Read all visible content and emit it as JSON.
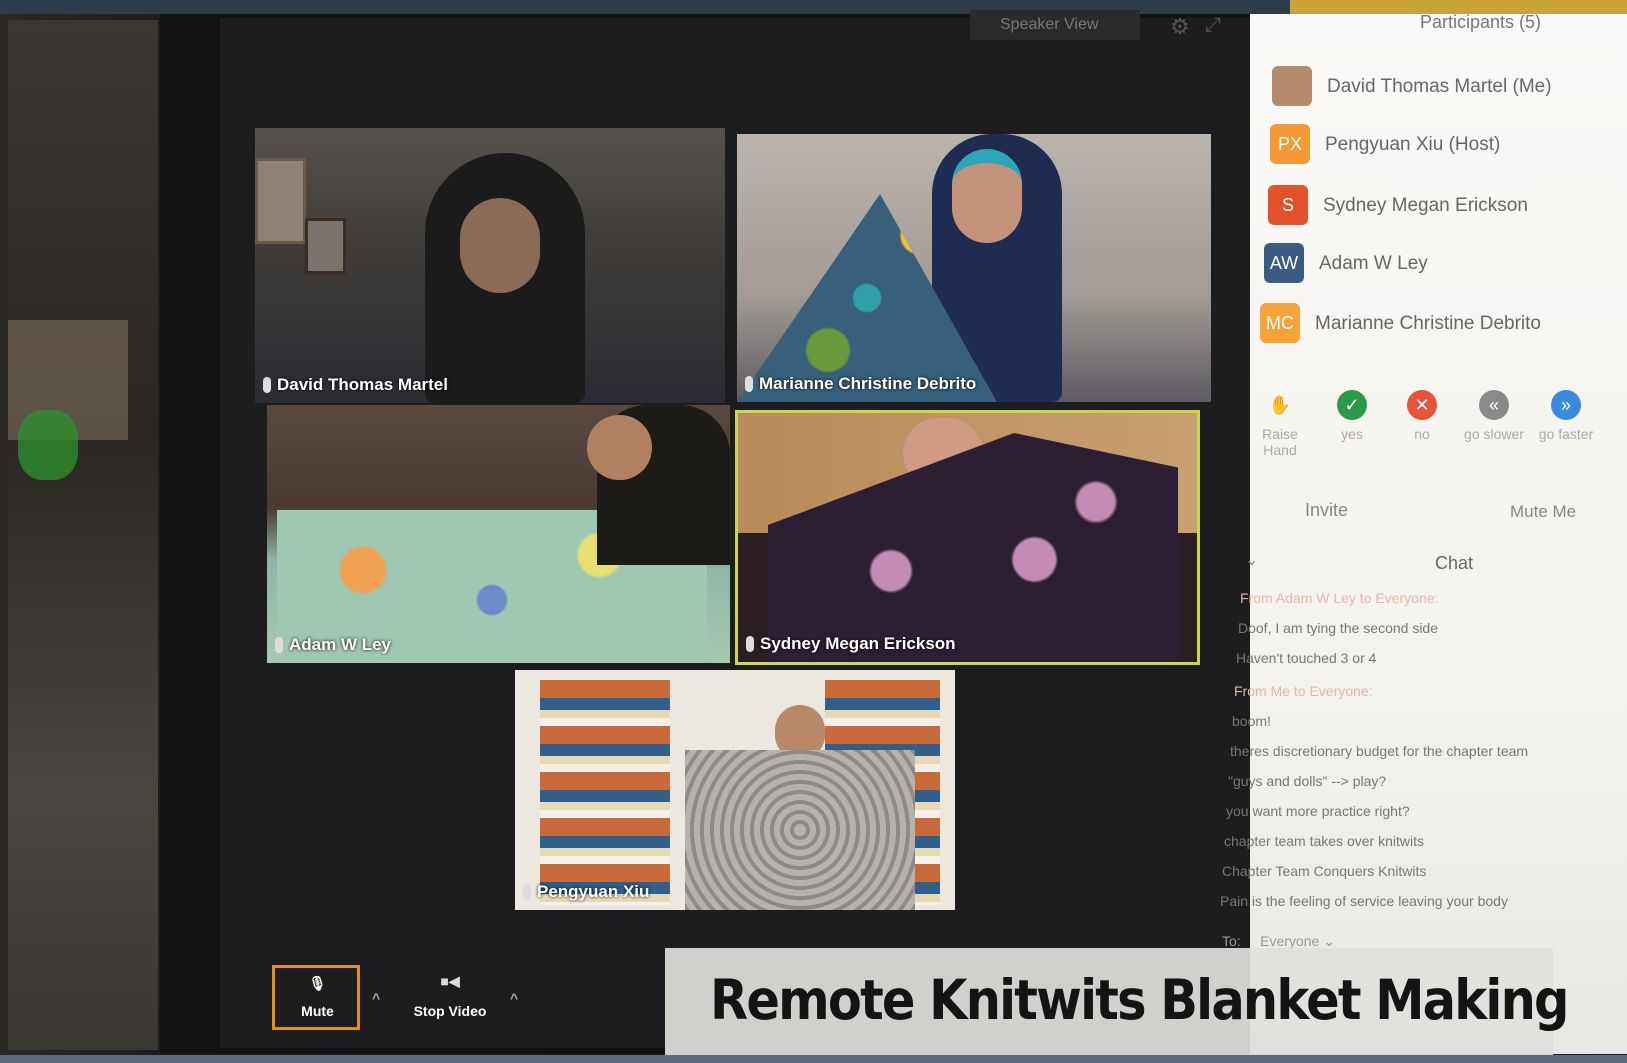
{
  "caption": "Remote Knitwits Blanket Making",
  "top_control": "Speaker View",
  "panel": {
    "title": "Participants (5)",
    "participants": [
      {
        "initials": "",
        "name": "David Thomas Martel (Me)",
        "color": "#b58a6a"
      },
      {
        "initials": "PX",
        "name": "Pengyuan Xiu (Host)",
        "color": "#f39a36"
      },
      {
        "initials": "S",
        "name": "Sydney Megan Erickson",
        "color": "#e2532a"
      },
      {
        "initials": "AW",
        "name": "Adam W Ley",
        "color": "#3b5b82"
      },
      {
        "initials": "MC",
        "name": "Marianne Christine Debrito",
        "color": "#f5a23b"
      }
    ],
    "reactions": [
      {
        "icon": "✋",
        "label": "Raise Hand",
        "color": "#3d8ae8"
      },
      {
        "icon": "✓",
        "label": "yes",
        "color": "#2a9a4a"
      },
      {
        "icon": "✕",
        "label": "no",
        "color": "#e8543a"
      },
      {
        "icon": "«",
        "label": "go slower",
        "color": "#8a8a8a"
      },
      {
        "icon": "»",
        "label": "go faster",
        "color": "#3a8ae0"
      }
    ],
    "invite": "Invite",
    "mute_me": "Mute Me",
    "chat_title": "Chat",
    "messages": [
      {
        "text": "From Adam W Ley to Everyone:",
        "meta": true
      },
      {
        "text": "Doof, I am tying the second side",
        "meta": false
      },
      {
        "text": "Haven't touched 3 or 4",
        "meta": false
      },
      {
        "text": "From Me to Everyone:",
        "meta": true
      },
      {
        "text": "boom!",
        "meta": false
      },
      {
        "text": "theres discretionary budget for the chapter team",
        "meta": false
      },
      {
        "text": "\"guys and dolls\" --> play?",
        "meta": false
      },
      {
        "text": "you want more practice right?",
        "meta": false
      },
      {
        "text": "chapter team takes over knitwits",
        "meta": false
      },
      {
        "text": "Chapter Team Conquers Knitwits",
        "meta": false
      },
      {
        "text": "Pain is the feeling of service leaving your body",
        "meta": false
      }
    ],
    "to_label": "To:",
    "to_value": "Everyone"
  },
  "tiles": [
    {
      "name": "David Thomas Martel"
    },
    {
      "name": "Marianne Christine Debrito"
    },
    {
      "name": "Adam W Ley"
    },
    {
      "name": "Sydney Megan Erickson"
    },
    {
      "name": "Pengyuan Xiu"
    }
  ],
  "toolbar": {
    "mute_label": "Mute",
    "video_label": "Stop Video"
  }
}
